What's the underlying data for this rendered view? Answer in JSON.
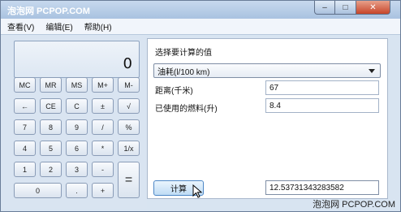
{
  "window": {
    "title": "",
    "watermark_top": "泡泡网 PCPOP.COM",
    "close_glyph": "✕",
    "min_glyph": "–",
    "max_glyph": "□"
  },
  "menu": [
    "查看(V)",
    "编辑(E)",
    "帮助(H)"
  ],
  "display": {
    "value": "0"
  },
  "keys": [
    "MC",
    "MR",
    "MS",
    "M+",
    "M-",
    "←",
    "CE",
    "C",
    "±",
    "√",
    "7",
    "8",
    "9",
    "/",
    "%",
    "4",
    "5",
    "6",
    "*",
    "1/x",
    "1",
    "2",
    "3",
    "-",
    "=",
    "0",
    ".",
    "+"
  ],
  "converter": {
    "title": "选择要计算的值",
    "type_selected": "油耗(l/100 km)",
    "distance_label": "距离(千米)",
    "distance_value": "67",
    "fuel_label": "已使用的燃料(升)",
    "fuel_value": "8.4",
    "calc_button": "计算",
    "result_value": "12.53731343283582"
  },
  "watermark": "泡泡网 PCPOP.COM"
}
